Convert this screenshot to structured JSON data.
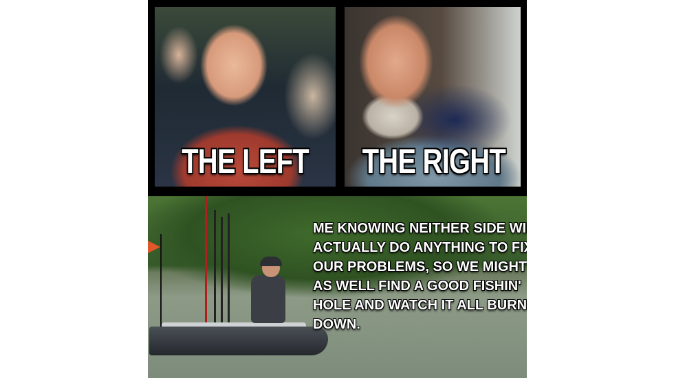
{
  "meme": {
    "top_left_caption": "THE LEFT",
    "top_right_caption": "THE RIGHT",
    "bottom_caption_lines": [
      "ME KNOWING NEITHER SIDE WILL",
      "ACTUALLY DO ANYTHING TO FIX",
      "OUR PROBLEMS, SO WE MIGHT",
      "AS WELL FIND A GOOD FISHIN'",
      "HOLE AND WATCH IT ALL BURN",
      "DOWN."
    ]
  },
  "colors": {
    "background": "#ffffff",
    "frame": "#000000",
    "caption_text": "#ffffff",
    "caption_outline": "#000000"
  }
}
